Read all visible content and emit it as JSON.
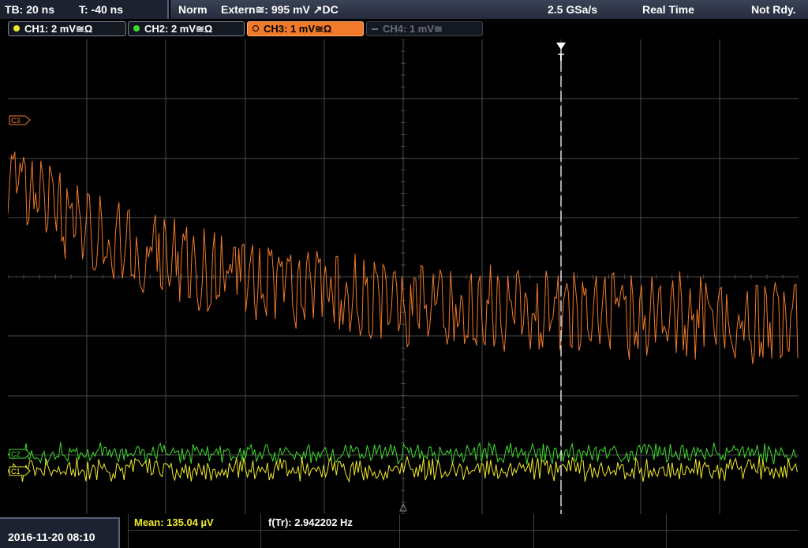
{
  "header": {
    "timebase": "TB: 20 ns",
    "trigger_time": "T: -40 ns",
    "trigger_mode": "Norm",
    "trigger_source": "Extern≅: 995 mV ↗DC",
    "sample_rate": "2.5 GSa/s",
    "acq_mode": "Real Time",
    "status": "Not Rdy."
  },
  "channels": [
    {
      "label": "CH1: 2 mV≅Ω",
      "color": "#f0ea2a",
      "state": "on"
    },
    {
      "label": "CH2: 2 mV≅Ω",
      "color": "#3cdc2a",
      "state": "on"
    },
    {
      "label": "CH3: 1 mV≅Ω",
      "color": "#f07a2a",
      "state": "active"
    },
    {
      "label": "CH4: 1 mV≅",
      "color": "#6a6e78",
      "state": "off"
    }
  ],
  "markers": {
    "ch3": "C3",
    "ch2": "C2",
    "ch1": "C1",
    "trigger": "T"
  },
  "footer": {
    "datetime": "2016-11-20 08:10",
    "mean_label": "Mean: 135.04 µV",
    "freq_label": "f(Tr): 2.942202 Hz"
  },
  "colors": {
    "ch1": "#f0ea2a",
    "ch2": "#3cdc2a",
    "ch3": "#f07a2a",
    "grid": "#4a4a4a"
  }
}
